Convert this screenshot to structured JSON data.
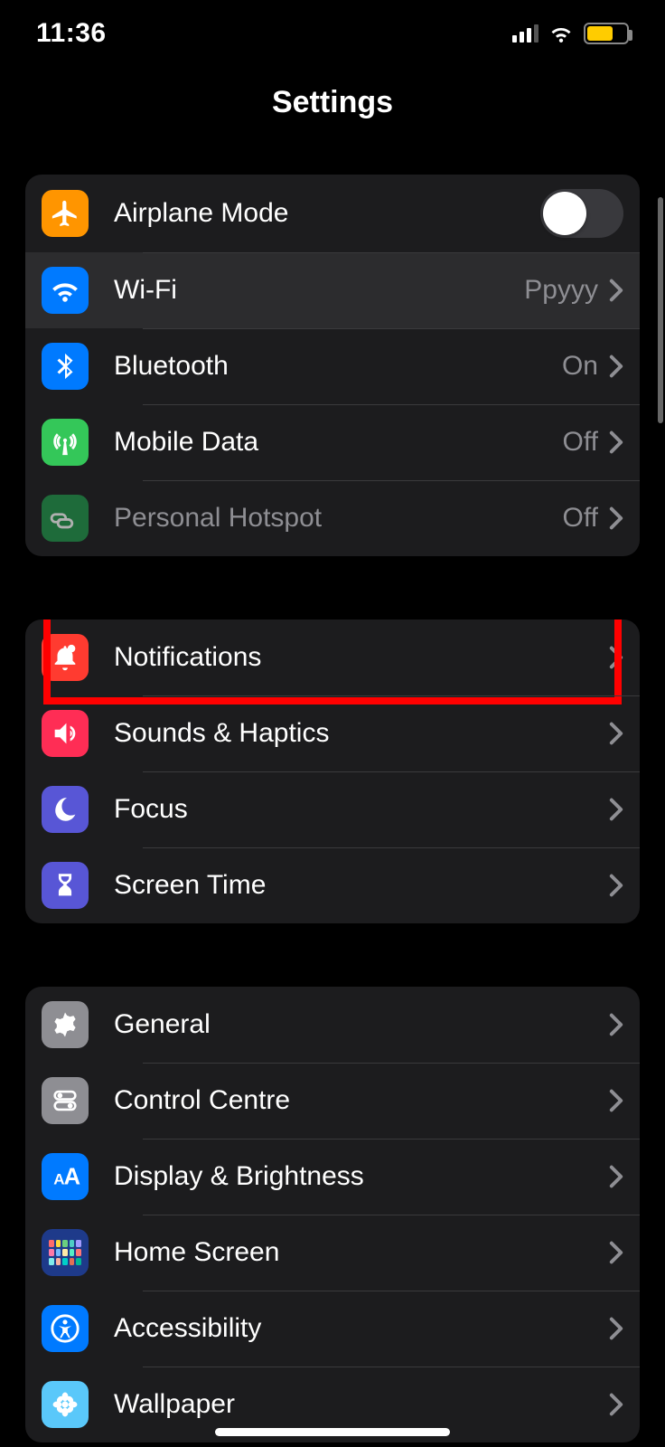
{
  "status": {
    "time": "11:36"
  },
  "header": {
    "title": "Settings"
  },
  "groups": [
    {
      "id": "connectivity",
      "rows": [
        {
          "id": "airplane",
          "label": "Airplane Mode",
          "icon": "airplane-icon",
          "color": "bg-orange",
          "type": "toggle",
          "toggle": false
        },
        {
          "id": "wifi",
          "label": "Wi-Fi",
          "icon": "wifi-icon",
          "color": "bg-blue",
          "type": "link",
          "value": "Ppyyy",
          "selected": true
        },
        {
          "id": "bluetooth",
          "label": "Bluetooth",
          "icon": "bluetooth-icon",
          "color": "bg-blue",
          "type": "link",
          "value": "On"
        },
        {
          "id": "mobiledata",
          "label": "Mobile Data",
          "icon": "antenna-icon",
          "color": "bg-green",
          "type": "link",
          "value": "Off"
        },
        {
          "id": "hotspot",
          "label": "Personal Hotspot",
          "icon": "hotspot-icon",
          "color": "bg-darkgreen",
          "type": "link",
          "value": "Off",
          "disabled": true
        }
      ]
    },
    {
      "id": "alerts",
      "rows": [
        {
          "id": "notifications",
          "label": "Notifications",
          "icon": "bell-icon",
          "color": "bg-red",
          "type": "link",
          "highlighted": true
        },
        {
          "id": "sounds",
          "label": "Sounds & Haptics",
          "icon": "speaker-icon",
          "color": "bg-pink",
          "type": "link"
        },
        {
          "id": "focus",
          "label": "Focus",
          "icon": "moon-icon",
          "color": "bg-indigo",
          "type": "link"
        },
        {
          "id": "screentime",
          "label": "Screen Time",
          "icon": "hourglass-icon",
          "color": "bg-indigo",
          "type": "link"
        }
      ]
    },
    {
      "id": "general-group",
      "rows": [
        {
          "id": "general",
          "label": "General",
          "icon": "gear-icon",
          "color": "bg-gray",
          "type": "link"
        },
        {
          "id": "control",
          "label": "Control Centre",
          "icon": "switches-icon",
          "color": "bg-gray",
          "type": "link"
        },
        {
          "id": "display",
          "label": "Display & Brightness",
          "icon": "textsize-icon",
          "color": "bg-blue",
          "type": "link"
        },
        {
          "id": "homescreen",
          "label": "Home Screen",
          "icon": "homescreen-icon",
          "color": "bg-homescreen",
          "type": "link"
        },
        {
          "id": "accessibility",
          "label": "Accessibility",
          "icon": "accessibility-icon",
          "color": "bg-blue",
          "type": "link"
        },
        {
          "id": "wallpaper",
          "label": "Wallpaper",
          "icon": "flower-icon",
          "color": "bg-lightblue",
          "type": "link"
        }
      ]
    }
  ]
}
